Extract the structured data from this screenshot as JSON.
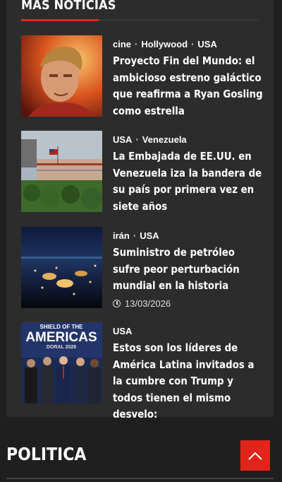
{
  "section": {
    "title": "MÁS NOTICIAS"
  },
  "articles": [
    {
      "tags": [
        "cine",
        "Hollywood",
        "USA"
      ],
      "title": "Proyecto Fin del Mundo: el ambicioso estreno galáctico que reafirma a Ryan Gosling como estrella",
      "thumb_icon": "actor-portrait-image"
    },
    {
      "tags": [
        "USA",
        "Venezuela"
      ],
      "title": "La Embajada de EE.UU. en Venezuela iza la bandera de su país por primera vez en siete años",
      "thumb_icon": "embassy-building-image"
    },
    {
      "tags": [
        "irán",
        "USA"
      ],
      "title": "Suministro de petróleo sufre peor perturbación mundial en la historia",
      "date": "13/03/2026",
      "thumb_icon": "oil-refinery-night-image"
    },
    {
      "tags": [
        "USA"
      ],
      "title": "Estos son los líderes de América Latina invitados a la cumbre con Trump y todos tienen el mismo desvelo:",
      "thumb_icon": "summit-leaders-image",
      "thumb_text": {
        "line1": "SHIELD OF THE",
        "line2": "AMERICAS",
        "line3": "DORAL 2026"
      }
    }
  ],
  "next_section": {
    "title": "POLITICA"
  },
  "colors": {
    "accent": "#e0251b",
    "panel": "#2c2c2c",
    "background": "#1f1f1f"
  }
}
